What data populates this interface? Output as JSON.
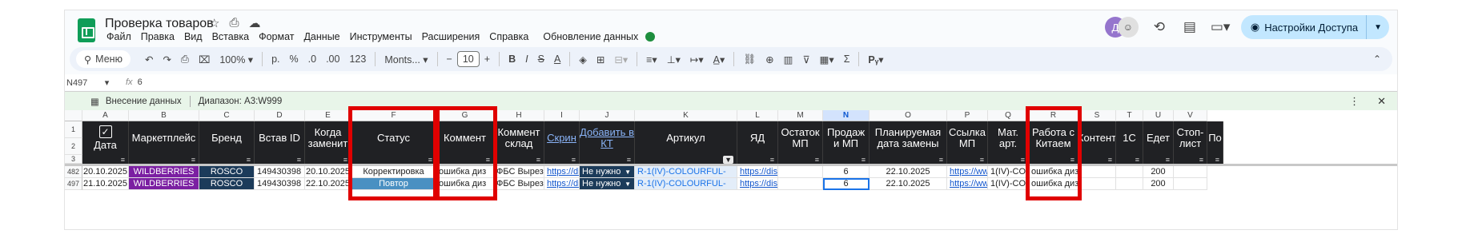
{
  "app": {
    "title": "Проверка товаров",
    "menu": [
      "Файл",
      "Правка",
      "Вид",
      "Вставка",
      "Формат",
      "Данные",
      "Инструменты",
      "Расширения",
      "Справка",
      "Обновление данных"
    ],
    "avatar_letter": "Д",
    "share_label": "Настройки Доступа"
  },
  "toolbar": {
    "menu_search": "Меню",
    "zoom": "100%",
    "currency": "р.",
    "percent": "%",
    "dec_less": ".0",
    "dec_more": ".00",
    "num_format": "123",
    "font": "Monts...",
    "font_size": "10"
  },
  "formula_bar": {
    "cell_ref": "N497",
    "fx": "fx",
    "value": "6"
  },
  "table_banner": {
    "name": "Внесение данных",
    "range": "Диапазон: A3:W999"
  },
  "columns": [
    "A",
    "B",
    "C",
    "D",
    "E",
    "F",
    "G",
    "H",
    "I",
    "J",
    "K",
    "L",
    "M",
    "N",
    "O",
    "P",
    "Q",
    "R",
    "S",
    "T",
    "U",
    "V"
  ],
  "header_row_numbers": [
    "1",
    "2",
    "3"
  ],
  "headers": {
    "A": "Дата",
    "B": "Маркетплейс",
    "C": "Бренд",
    "D": "Встав ID",
    "E": "Когда заменит",
    "F": "Статус",
    "G": "Коммент",
    "H": "Коммент склад",
    "I": "Скрин",
    "J": "Добавить в КТ",
    "K": "Артикул",
    "L": "ЯД",
    "M": "Остаток МП",
    "N": "Продаж и МП",
    "O": "Планируемая дата замены",
    "P": "Ссылка МП",
    "Q": "Мат. арт.",
    "R": "Работа с Китаем",
    "S": "Контент",
    "T": "1С",
    "U": "Едет",
    "V": "Стоп-лист",
    "W": "По"
  },
  "rows": [
    {
      "num": "482",
      "A": "20.10.2025",
      "B": "WILDBERRIES",
      "C": "ROSCO",
      "D": "149430398",
      "E": "20.10.2025",
      "F": "Корректировка",
      "G": "ошибка диз",
      "H": "ФБС Вырез с",
      "I": "https://di",
      "J": "Не нужно",
      "K": "R-1(IV)-COLOURFUL-",
      "L": "https://disl",
      "M": "",
      "N": "6",
      "O": "22.10.2025",
      "P": "https://ww",
      "Q": "1(IV)-COL",
      "R": "ошибка диз",
      "S": "",
      "T": "",
      "U": "200",
      "V": ""
    },
    {
      "num": "497",
      "A": "21.10.2025",
      "B": "WILDBERRIES",
      "C": "ROSCO",
      "D": "149430398",
      "E": "22.10.2025",
      "F": "Повтор",
      "G": "ошибка диз",
      "H": "ФБС Вырез с",
      "I": "https://di",
      "J": "Не нужно",
      "K": "R-1(IV)-COLOURFUL-",
      "L": "https://disl",
      "M": "",
      "N": "6",
      "O": "22.10.2025",
      "P": "https://ww",
      "Q": "1(IV)-COL",
      "R": "ошибка диз",
      "S": "",
      "T": "",
      "U": "200",
      "V": ""
    }
  ],
  "colors": {
    "wildberries": "#7b1fa2",
    "rosco": "#1c3b5a",
    "povtor": "#4a90c2",
    "header_bg": "#202124",
    "highlight_red": "#e00000",
    "share_button": "#c2e7ff"
  }
}
